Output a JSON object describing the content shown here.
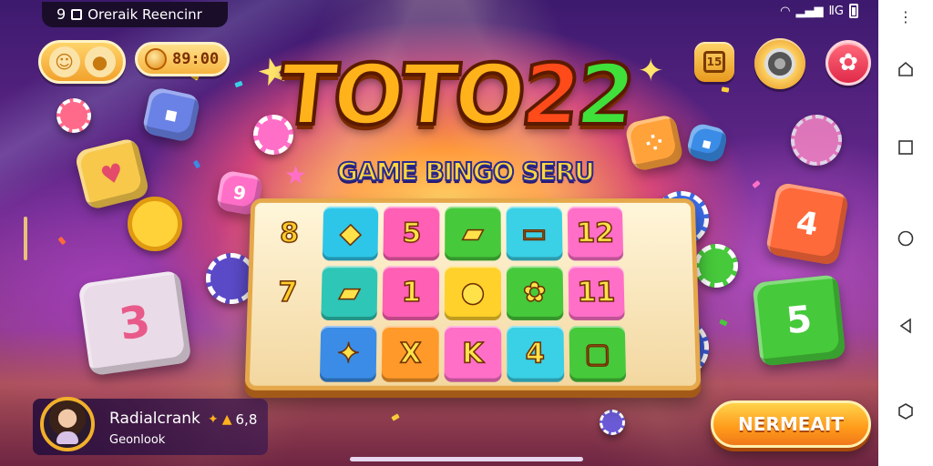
{
  "status_bar": {
    "time": "9",
    "notification_text": "Oreraik Reencinr",
    "signal_text": "ⅡG"
  },
  "top_bar": {
    "coins": "89:00",
    "calendar_glyph": "15"
  },
  "title": {
    "part1": "TOTO",
    "part2": "2",
    "part3": "2",
    "subtitle": "GAME BINGO SERU"
  },
  "board": {
    "cells": [
      {
        "label": "8",
        "color": "plain"
      },
      {
        "label": "◆",
        "color": "#2ec6e8"
      },
      {
        "label": "5",
        "color": "#ff5fb4"
      },
      {
        "label": "▰",
        "color": "#46c93a"
      },
      {
        "label": "▭",
        "color": "#3ad0e6"
      },
      {
        "label": "12",
        "color": "#ff6fc8"
      },
      {
        "label": "",
        "color": "plain"
      },
      {
        "label": "7",
        "color": "plain"
      },
      {
        "label": "▰",
        "color": "#2ec6b6"
      },
      {
        "label": "1",
        "color": "#ff5fb4"
      },
      {
        "label": "●",
        "color": "#ffd12a"
      },
      {
        "label": "✿",
        "color": "#46c93a"
      },
      {
        "label": "11",
        "color": "#ff6fc8"
      },
      {
        "label": "",
        "color": "plain"
      },
      {
        "label": "",
        "color": "plain"
      },
      {
        "label": "✦",
        "color": "#3a8ce6"
      },
      {
        "label": "X",
        "color": "#ff9a2a"
      },
      {
        "label": "K",
        "color": "#ff6fc8"
      },
      {
        "label": "4",
        "color": "#3ad0e6"
      },
      {
        "label": "▢",
        "color": "#46c93a"
      },
      {
        "label": "",
        "color": "plain"
      }
    ]
  },
  "player": {
    "name": "Radialcrank",
    "score": "6,8",
    "sub": "Geonlook"
  },
  "cta": {
    "label": "NERMEAIT"
  },
  "colors": {
    "accent": "#ffb21a",
    "cta": "#ff9a1a",
    "board_frame": "#e5a84a"
  }
}
